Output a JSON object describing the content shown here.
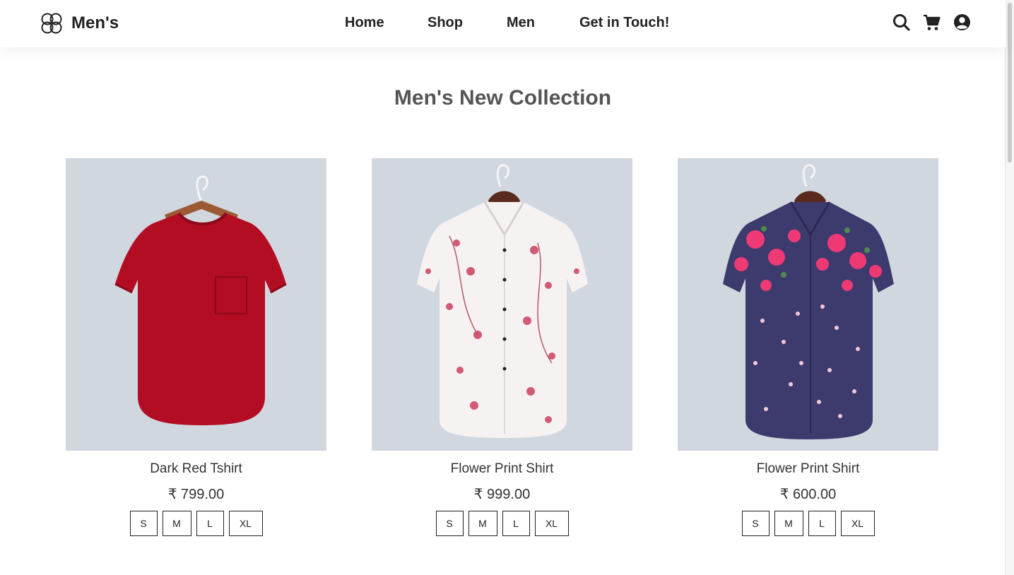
{
  "brand": {
    "name": "Men's",
    "logo_icon": "clover-knot-icon"
  },
  "nav": {
    "links": [
      "Home",
      "Shop",
      "Men",
      "Get in Touch!"
    ],
    "icons": [
      "search-icon",
      "cart-icon",
      "user-circle-icon"
    ]
  },
  "page": {
    "title": "Men's New Collection"
  },
  "products": [
    {
      "name": "Dark Red Tshirt",
      "price": "₹ 799.00",
      "image": "dark-red-tshirt-image",
      "color": "#b30d23",
      "sizes": [
        "S",
        "M",
        "L",
        "XL"
      ]
    },
    {
      "name": "Flower Print Shirt",
      "price": "₹ 999.00",
      "image": "white-flower-shirt-image",
      "color": "#f6f2f2",
      "sizes": [
        "S",
        "M",
        "L",
        "XL"
      ]
    },
    {
      "name": "Flower Print Shirt",
      "price": "₹ 600.00",
      "image": "navy-flower-shirt-image",
      "color": "#3d3a6e",
      "sizes": [
        "S",
        "M",
        "L",
        "XL"
      ]
    }
  ],
  "colors": {
    "image_bg": "#d1d7df",
    "title": "#555555",
    "text": "#222222"
  }
}
